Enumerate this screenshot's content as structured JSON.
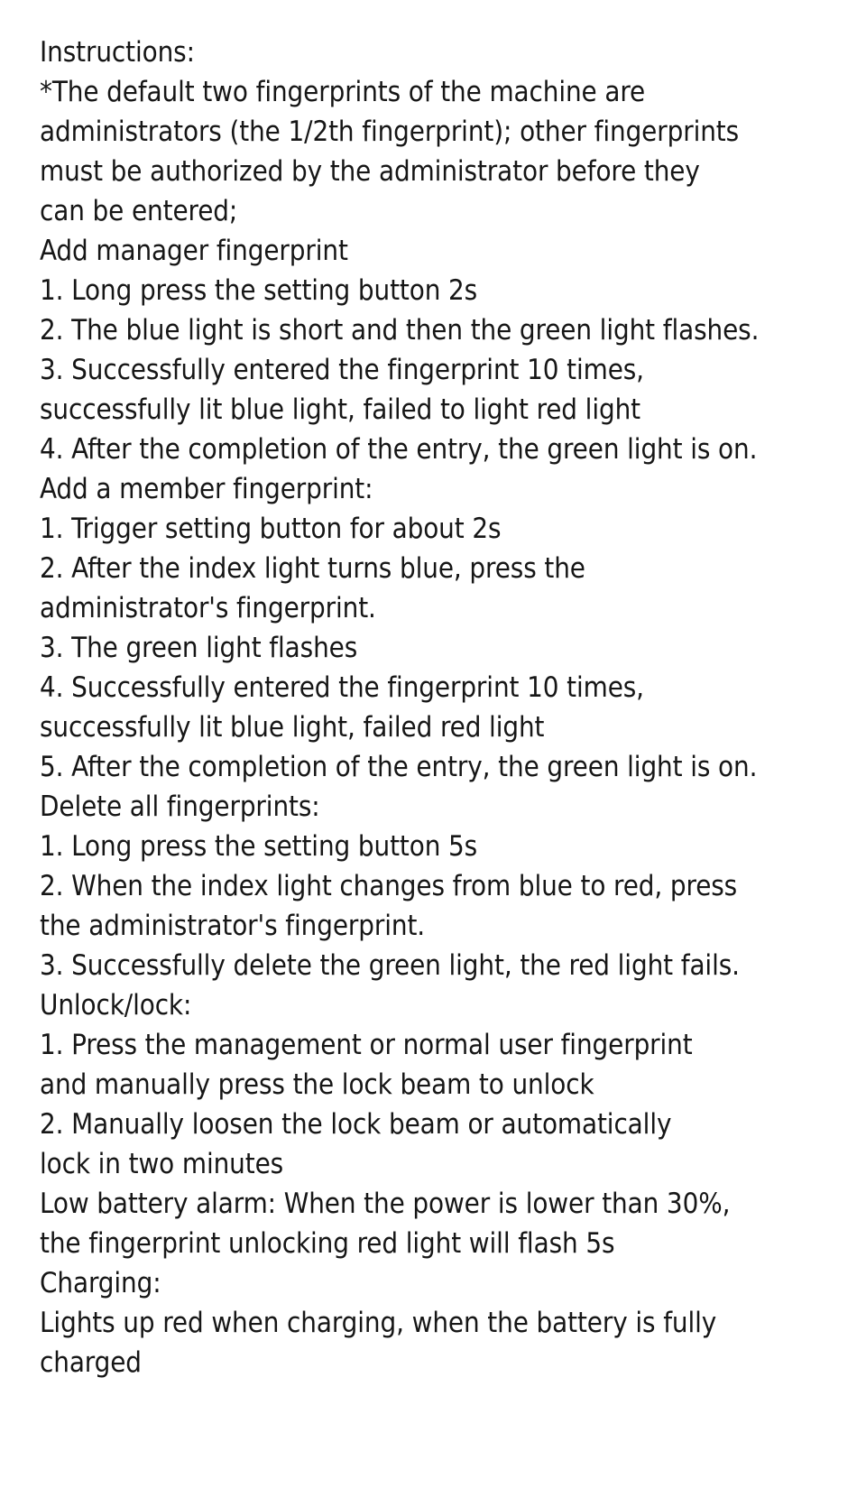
{
  "document": {
    "title": "Instructions:",
    "note": "*The default two fingerprints of the machine are administrators (the 1/2th fingerprint); other fingerprints must be authorized by the administrator before they can be entered;",
    "text_color": "#161616",
    "background_color": "#ffffff"
  },
  "lines": [
    "Instructions:",
    "*The default two fingerprints of the machine are",
    "administrators (the 1/2th fingerprint); other fingerprints",
    "must be authorized by the administrator before they",
    "can be entered;",
    "Add manager fingerprint",
    "1. Long press the setting button 2s",
    "2. The blue light is short and then the green light flashes.",
    "3. Successfully entered the fingerprint 10 times,",
    "successfully lit blue light, failed to light red light",
    "4. After the completion of the entry, the green light is on.",
    "Add a member fingerprint:",
    "1. Trigger setting button for about 2s",
    "2. After the index light turns blue, press the",
    "administrator's fingerprint.",
    "3. The green light flashes",
    "4. Successfully entered the fingerprint 10 times,",
    "successfully lit blue light, failed red light",
    "5. After the completion of the entry, the green light is on.",
    "Delete all fingerprints:",
    "1. Long press the setting button 5s",
    "2. When the index light changes from blue to red, press",
    "the administrator's fingerprint.",
    "3. Successfully delete the green light, the red light fails.",
    "Unlock/lock:",
    "1. Press the management or normal user fingerprint",
    "and manually press the lock beam to unlock",
    "2. Manually loosen the lock beam or automatically",
    "lock in two minutes",
    "Low battery alarm: When the power is lower than 30%,",
    "the fingerprint unlocking red light will flash 5s",
    "Charging:",
    "Lights up red when charging, when the battery is fully",
    "charged"
  ],
  "sections": [
    {
      "id": "add-manager-fingerprint",
      "heading": "Add manager fingerprint",
      "steps": [
        "1. Long press the setting button 2s",
        "2. The blue light is short and then the green light flashes.",
        "3. Successfully entered the fingerprint 10 times, successfully lit blue light, failed to light red light",
        "4. After the completion of the entry, the green light is on."
      ]
    },
    {
      "id": "add-member-fingerprint",
      "heading": "Add a member fingerprint:",
      "steps": [
        "1. Trigger setting button for about 2s",
        "2. After the index light turns blue, press the administrator's fingerprint.",
        "3. The green light flashes",
        "4. Successfully entered the fingerprint 10 times, successfully lit blue light, failed red light",
        "5. After the completion of the entry, the green light is on."
      ]
    },
    {
      "id": "delete-all-fingerprints",
      "heading": "Delete all fingerprints:",
      "steps": [
        "1. Long press the setting button 5s",
        "2. When the index light changes from blue to red, press the administrator's fingerprint.",
        "3. Successfully delete the green light, the red light fails."
      ]
    },
    {
      "id": "unlock-lock",
      "heading": "Unlock/lock:",
      "steps": [
        "1. Press the management or normal user fingerprint and manually press the lock beam to unlock",
        "2. Manually loosen the lock beam or automatically lock in two minutes"
      ]
    },
    {
      "id": "low-battery-alarm",
      "heading": "Low battery alarm: When the power is lower than 30%, the fingerprint unlocking red light will flash 5s",
      "steps": []
    },
    {
      "id": "charging",
      "heading": "Charging:",
      "steps": [
        "Lights up red when charging, when the battery is fully charged"
      ]
    }
  ]
}
